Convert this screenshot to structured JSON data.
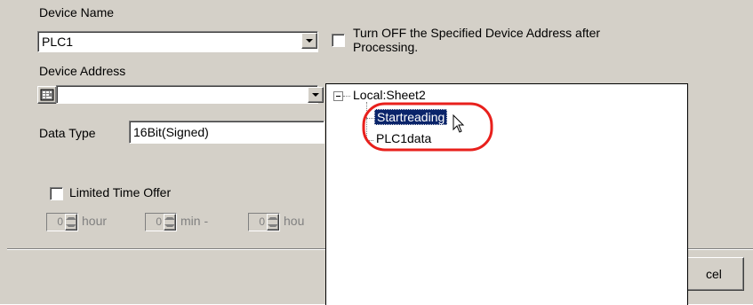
{
  "device_name": {
    "label": "Device Name",
    "value": "PLC1"
  },
  "turn_off_option": {
    "label_line1": "Turn OFF the Specified Device Address after",
    "label_line2": "Processing."
  },
  "device_address": {
    "label": "Device Address",
    "value": ""
  },
  "data_type": {
    "label": "Data Type",
    "value": "16Bit(Signed)"
  },
  "limited_time": {
    "label": "Limited Time Offer",
    "hour_value": "0",
    "hour_label": "hour",
    "min_value": "0",
    "min_label": "min -",
    "end_value": "0",
    "end_label": "hou"
  },
  "tree": {
    "root": "Local:Sheet2",
    "items": [
      {
        "label": "Startreading",
        "selected": true
      },
      {
        "label": "PLC1data",
        "selected": false
      }
    ]
  },
  "cancel_button": {
    "label": "cel"
  },
  "colors": {
    "selection": "#0a246a",
    "highlight_circle": "#e8201c",
    "dialog_bg": "#d4d0c8"
  }
}
